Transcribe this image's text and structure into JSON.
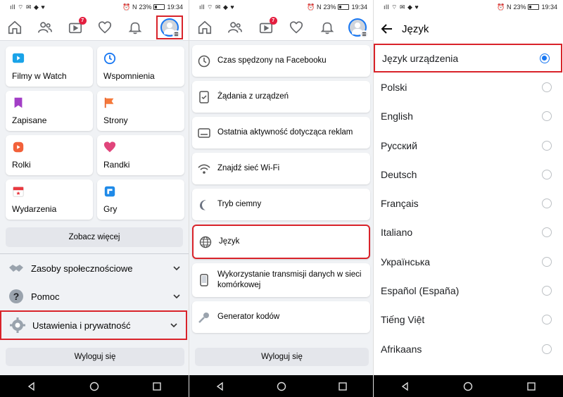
{
  "status_bar": {
    "signal_text": "ıll",
    "battery_text": "23%",
    "time": "19:34"
  },
  "colors": {
    "accent": "#1877f2",
    "highlight": "#d9232a",
    "notification_badge": "#e41e3f"
  },
  "topnav": {
    "icons": [
      "home-icon",
      "friends-icon",
      "watch-icon",
      "heart-icon",
      "bell-icon",
      "profile-menu-icon"
    ],
    "watch_badge": "7"
  },
  "panel1": {
    "tiles": [
      {
        "label": "Filmy w Watch",
        "icon": "watch-video-icon"
      },
      {
        "label": "Wspomnienia",
        "icon": "memories-clock-icon"
      },
      {
        "label": "Zapisane",
        "icon": "bookmark-icon"
      },
      {
        "label": "Strony",
        "icon": "flag-icon"
      },
      {
        "label": "Rolki",
        "icon": "reels-icon"
      },
      {
        "label": "Randki",
        "icon": "dating-heart-icon"
      },
      {
        "label": "Wydarzenia",
        "icon": "calendar-icon"
      },
      {
        "label": "Gry",
        "icon": "gaming-icon"
      }
    ],
    "see_more": "Zobacz więcej",
    "accordion": [
      {
        "label": "Zasoby społecznościowe",
        "icon": "handshake-icon"
      },
      {
        "label": "Pomoc",
        "icon": "question-icon"
      },
      {
        "label": "Ustawienia i prywatność",
        "icon": "gear-icon"
      }
    ],
    "logout": "Wyloguj się"
  },
  "panel2": {
    "items": [
      {
        "label": "Czas spędzony na Facebooku",
        "icon": "clock-icon"
      },
      {
        "label": "Żądania z urządzeń",
        "icon": "device-request-icon"
      },
      {
        "label": "Ostatnia aktywność dotycząca reklam",
        "icon": "ad-activity-icon"
      },
      {
        "label": "Znajdź sieć Wi-Fi",
        "icon": "wifi-icon"
      },
      {
        "label": "Tryb ciemny",
        "icon": "moon-icon"
      },
      {
        "label": "Język",
        "icon": "globe-icon"
      },
      {
        "label": "Wykorzystanie transmisji danych w sieci komórkowej",
        "icon": "phone-data-icon"
      },
      {
        "label": "Generator kodów",
        "icon": "key-icon"
      }
    ],
    "logout": "Wyloguj się"
  },
  "panel3": {
    "title": "Język",
    "languages": [
      {
        "label": "Język urządzenia",
        "selected": true
      },
      {
        "label": "Polski",
        "selected": false
      },
      {
        "label": "English",
        "selected": false
      },
      {
        "label": "Русский",
        "selected": false
      },
      {
        "label": "Deutsch",
        "selected": false
      },
      {
        "label": "Français",
        "selected": false
      },
      {
        "label": "Italiano",
        "selected": false
      },
      {
        "label": "Українська",
        "selected": false
      },
      {
        "label": "Español (España)",
        "selected": false
      },
      {
        "label": "Tiếng Việt",
        "selected": false
      },
      {
        "label": "Afrikaans",
        "selected": false
      }
    ]
  }
}
